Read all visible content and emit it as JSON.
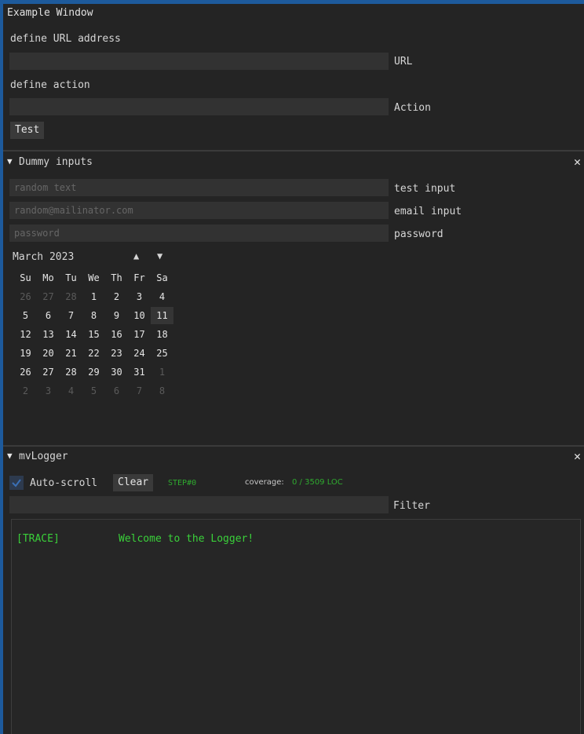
{
  "window": {
    "title": "Example Window"
  },
  "top": {
    "url_label_caption": "define URL address",
    "url_value": "",
    "url_label": "URL",
    "action_caption": "define action",
    "action_value": "",
    "action_label": "Action",
    "test_button": "Test"
  },
  "dummy": {
    "header": "Dummy inputs",
    "fields": [
      {
        "placeholder": "random text",
        "label": "test input"
      },
      {
        "placeholder": "random@mailinator.com",
        "label": "email input"
      },
      {
        "placeholder": "password",
        "label": "password"
      }
    ],
    "calendar": {
      "month_year": "March 2023",
      "up": "▲",
      "down": "▼",
      "weekdays": [
        "Su",
        "Mo",
        "Tu",
        "We",
        "Th",
        "Fr",
        "Sa"
      ],
      "weeks": [
        [
          "26",
          "27",
          "28",
          "1",
          "2",
          "3",
          "4"
        ],
        [
          "5",
          "6",
          "7",
          "8",
          "9",
          "10",
          "11"
        ],
        [
          "12",
          "13",
          "14",
          "15",
          "16",
          "17",
          "18"
        ],
        [
          "19",
          "20",
          "21",
          "22",
          "23",
          "24",
          "25"
        ],
        [
          "26",
          "27",
          "28",
          "29",
          "30",
          "31",
          "1"
        ],
        [
          "2",
          "3",
          "4",
          "5",
          "6",
          "7",
          "8"
        ]
      ],
      "selected_day": "11"
    }
  },
  "logger": {
    "header": "mvLogger",
    "autoscroll_label": "Auto-scroll",
    "autoscroll_checked": true,
    "clear_button": "Clear",
    "step": "STEP#0",
    "coverage_label": "coverage:",
    "coverage_value": "0 / 3509 LOC",
    "filter_value": "",
    "filter_label": "Filter",
    "entries": [
      {
        "level": "[TRACE]",
        "message": "Welcome to the Logger!"
      }
    ],
    "trace_color": "#3ad13a"
  },
  "icons": {
    "collapse": "▼",
    "close": "✕"
  }
}
